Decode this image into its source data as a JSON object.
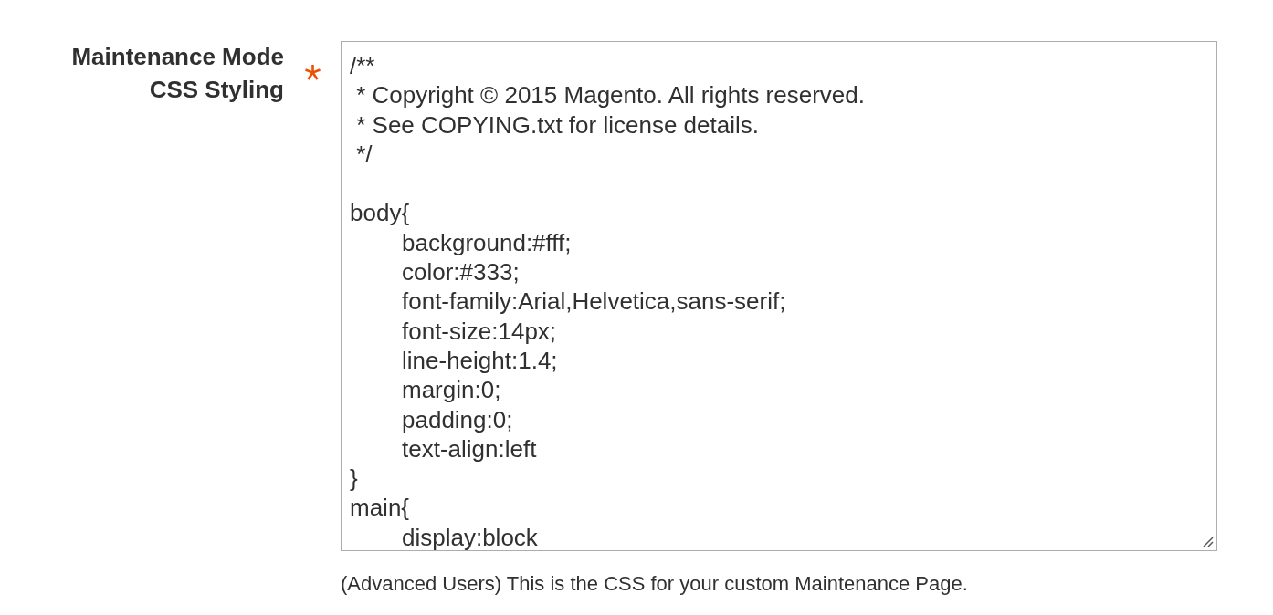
{
  "field": {
    "label": "Maintenance Mode CSS Styling",
    "required": true,
    "value": "/**\n * Copyright © 2015 Magento. All rights reserved.\n * See COPYING.txt for license details.\n */\n\nbody{\n\tbackground:#fff;\n\tcolor:#333;\n\tfont-family:Arial,Helvetica,sans-serif;\n\tfont-size:14px;\n\tline-height:1.4;\n\tmargin:0;\n\tpadding:0;\n\ttext-align:left\n}\nmain{\n\tdisplay:block",
    "note": "(Advanced Users) This is the CSS for your custom Maintenance Page."
  }
}
